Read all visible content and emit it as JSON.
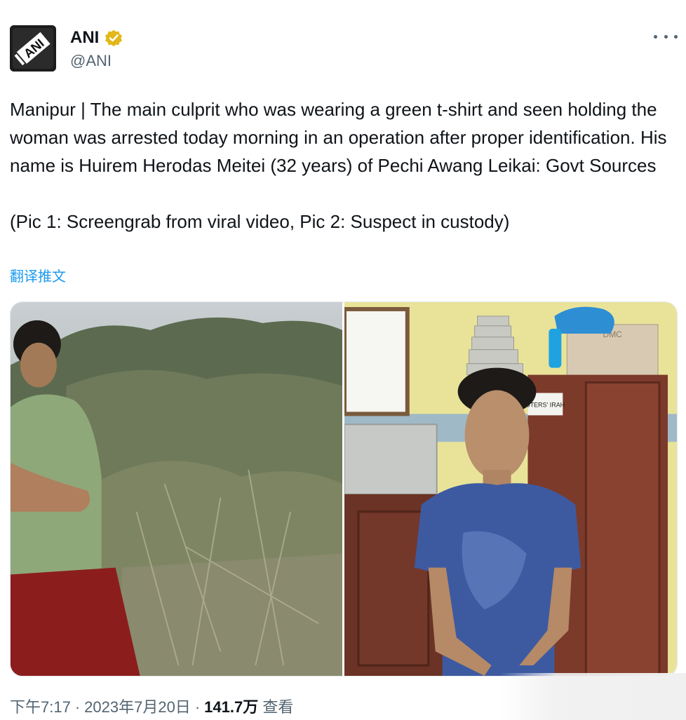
{
  "tweet": {
    "author": {
      "display_name": "ANI",
      "handle": "@ANI",
      "avatar_text": "ANI",
      "avatar_icon": "ani-logo-icon",
      "verified_icon": "gold-verified-badge-icon"
    },
    "more_icon": "more-horizontal-icon",
    "text": "Manipur | The main culprit who was wearing a green t-shirt and seen holding the woman was arrested today morning in an operation after proper identification. His name is Huirem Herodas Meitei (32 years) of Pechi Awang Leikai: Govt Sources\n\n(Pic 1: Screengrab from viral video, Pic 2: Suspect in custody)",
    "translate_label": "翻译推文",
    "media": [
      {
        "alt": "Pic 1"
      },
      {
        "alt": "Pic 2",
        "cabinet_label": "STERS' IRAH",
        "box_label": "DMC"
      }
    ],
    "meta": {
      "time": "下午7:17",
      "separator": "·",
      "date": "2023年7月20日",
      "views_count": "141.7万",
      "views_label": "查看"
    }
  },
  "colors": {
    "text_primary": "#0f1419",
    "text_secondary": "#536471",
    "link": "#1d9bf0",
    "badge_gold": "#e2b719"
  }
}
